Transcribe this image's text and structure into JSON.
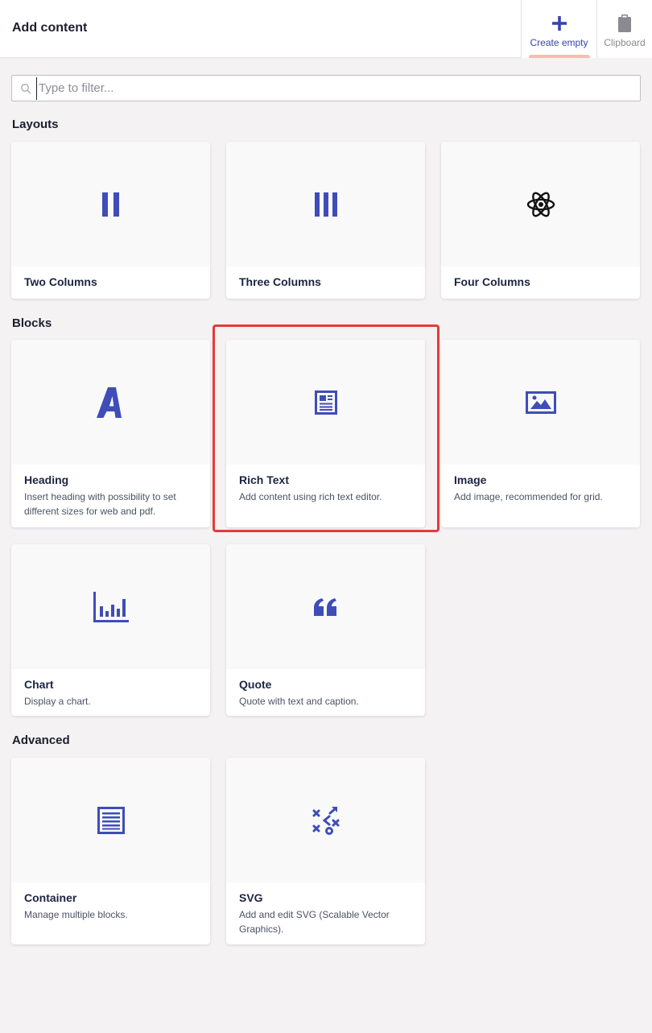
{
  "header": {
    "title": "Add content",
    "tabs": [
      {
        "label": "Create empty",
        "icon": "plus-icon"
      },
      {
        "label": "Clipboard",
        "icon": "clipboard-icon"
      }
    ]
  },
  "search": {
    "placeholder": "Type to filter...",
    "value": ""
  },
  "sections": [
    {
      "title": "Layouts",
      "items": [
        {
          "name": "Two Columns",
          "description": "",
          "icon": "two-columns-icon"
        },
        {
          "name": "Three Columns",
          "description": "",
          "icon": "three-columns-icon"
        },
        {
          "name": "Four Columns",
          "description": "",
          "icon": "atom-icon"
        }
      ]
    },
    {
      "title": "Blocks",
      "items": [
        {
          "name": "Heading",
          "description": "Insert heading with possibility to set different sizes for web and pdf.",
          "icon": "heading-icon"
        },
        {
          "name": "Rich Text",
          "description": "Add content using rich text editor.",
          "icon": "rich-text-icon"
        },
        {
          "name": "Image",
          "description": "Add image, recommended for grid.",
          "icon": "image-icon"
        },
        {
          "name": "Chart",
          "description": "Display a chart.",
          "icon": "chart-icon"
        },
        {
          "name": "Quote",
          "description": "Quote with text and caption.",
          "icon": "quote-icon"
        }
      ]
    },
    {
      "title": "Advanced",
      "items": [
        {
          "name": "Container",
          "description": "Manage multiple blocks.",
          "icon": "container-icon"
        },
        {
          "name": "SVG",
          "description": "Add and edit SVG (Scalable Vector Graphics).",
          "icon": "svg-icon"
        }
      ]
    }
  ],
  "colors": {
    "accent": "#3f4db8",
    "tab_indicator": "#f6bdb1",
    "highlight": "#e43b3b"
  }
}
